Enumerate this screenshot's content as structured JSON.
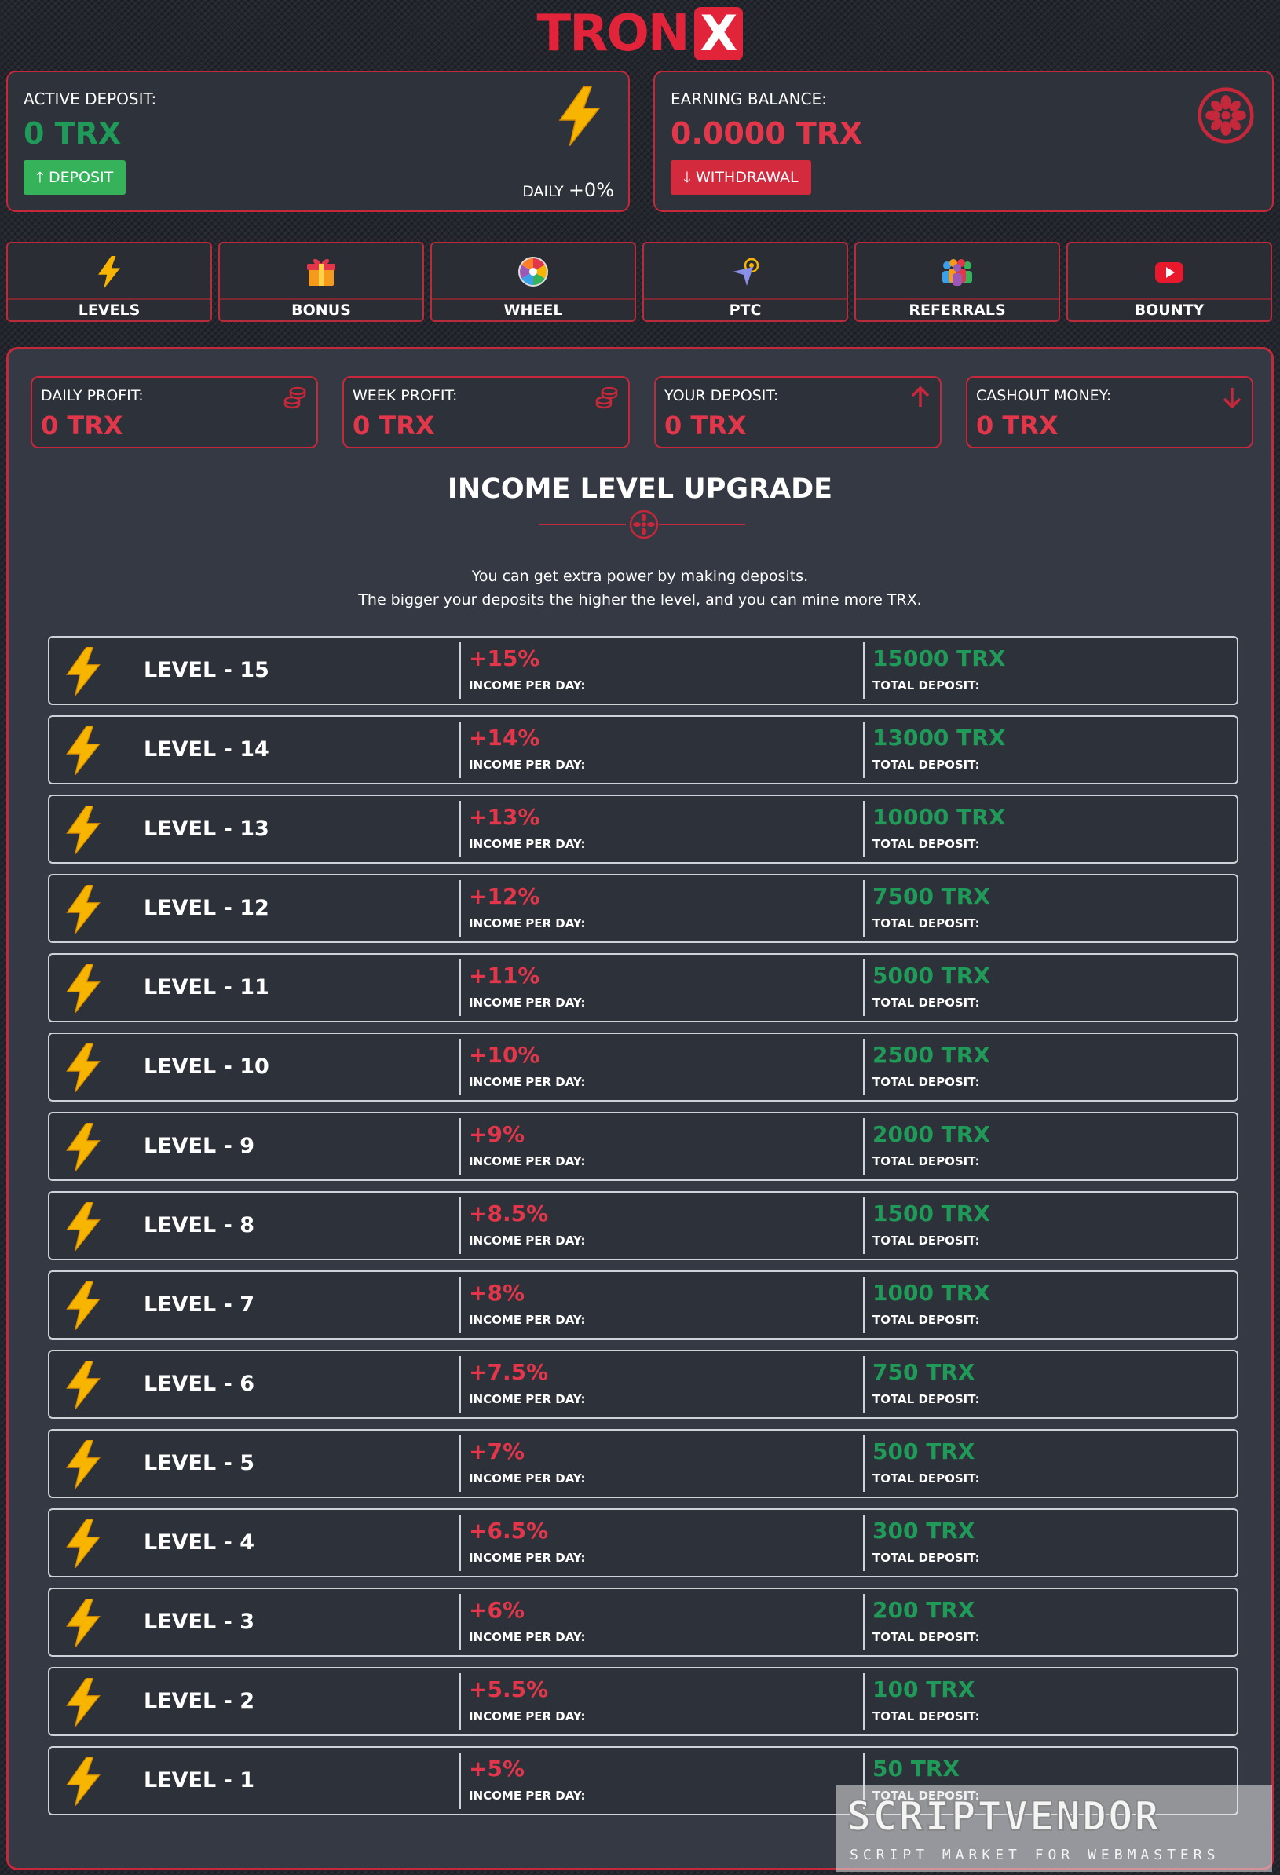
{
  "header": {
    "logo_text": "TRON",
    "logo_mark": "X"
  },
  "active_deposit": {
    "label": "ACTIVE DEPOSIT:",
    "amount": "0 TRX",
    "button": "DEPOSIT",
    "daily_label": "DAILY",
    "daily_value": "+0%",
    "icon": "lightning-icon"
  },
  "earning_balance": {
    "label": "EARNING BALANCE:",
    "amount": "0.0000 TRX",
    "button": "WITHDRAWAL",
    "icon": "wheel-icon"
  },
  "nav": [
    {
      "label": "LEVELS",
      "icon": "lightning-icon"
    },
    {
      "label": "BONUS",
      "icon": "gift-icon"
    },
    {
      "label": "WHEEL",
      "icon": "wheel-icon"
    },
    {
      "label": "PTC",
      "icon": "cursor-click-icon"
    },
    {
      "label": "REFERRALS",
      "icon": "people-icon"
    },
    {
      "label": "BOUNTY",
      "icon": "youtube-icon"
    }
  ],
  "stats": [
    {
      "label": "DAILY PROFIT:",
      "amount": "0 TRX",
      "icon": "coins-icon"
    },
    {
      "label": "WEEK PROFIT:",
      "amount": "0 TRX",
      "icon": "coins-icon"
    },
    {
      "label": "YOUR DEPOSIT:",
      "amount": "0 TRX",
      "icon": "arrow-up-icon"
    },
    {
      "label": "CASHOUT MONEY:",
      "amount": "0 TRX",
      "icon": "arrow-down-icon"
    }
  ],
  "section": {
    "title": "INCOME LEVEL UPGRADE",
    "desc1": "You can get extra power by making deposits.",
    "desc2": "The bigger your deposits the higher the level, and you can mine more TRX.",
    "income_label": "INCOME PER DAY:",
    "deposit_label": "TOTAL DEPOSIT:"
  },
  "levels": [
    {
      "name": "LEVEL - 15",
      "income": "+15%",
      "deposit": "15000 TRX"
    },
    {
      "name": "LEVEL - 14",
      "income": "+14%",
      "deposit": "13000 TRX"
    },
    {
      "name": "LEVEL - 13",
      "income": "+13%",
      "deposit": "10000 TRX"
    },
    {
      "name": "LEVEL - 12",
      "income": "+12%",
      "deposit": "7500 TRX"
    },
    {
      "name": "LEVEL - 11",
      "income": "+11%",
      "deposit": "5000 TRX"
    },
    {
      "name": "LEVEL - 10",
      "income": "+10%",
      "deposit": "2500 TRX"
    },
    {
      "name": "LEVEL - 9",
      "income": "+9%",
      "deposit": "2000 TRX"
    },
    {
      "name": "LEVEL - 8",
      "income": "+8.5%",
      "deposit": "1500 TRX"
    },
    {
      "name": "LEVEL - 7",
      "income": "+8%",
      "deposit": "1000 TRX"
    },
    {
      "name": "LEVEL - 6",
      "income": "+7.5%",
      "deposit": "750 TRX"
    },
    {
      "name": "LEVEL - 5",
      "income": "+7%",
      "deposit": "500 TRX"
    },
    {
      "name": "LEVEL - 4",
      "income": "+6.5%",
      "deposit": "300 TRX"
    },
    {
      "name": "LEVEL - 3",
      "income": "+6%",
      "deposit": "200 TRX"
    },
    {
      "name": "LEVEL - 2",
      "income": "+5.5%",
      "deposit": "100 TRX"
    },
    {
      "name": "LEVEL - 1",
      "income": "+5%",
      "deposit": "50 TRX"
    }
  ],
  "watermark": {
    "line1": "SCRIPTVENDOR",
    "line2": "SCRIPT MARKET FOR WEBMASTERS"
  },
  "colors": {
    "accent": "#e2243a",
    "positive": "#1f9a58",
    "panel": "#343944",
    "background": "#23262d"
  }
}
